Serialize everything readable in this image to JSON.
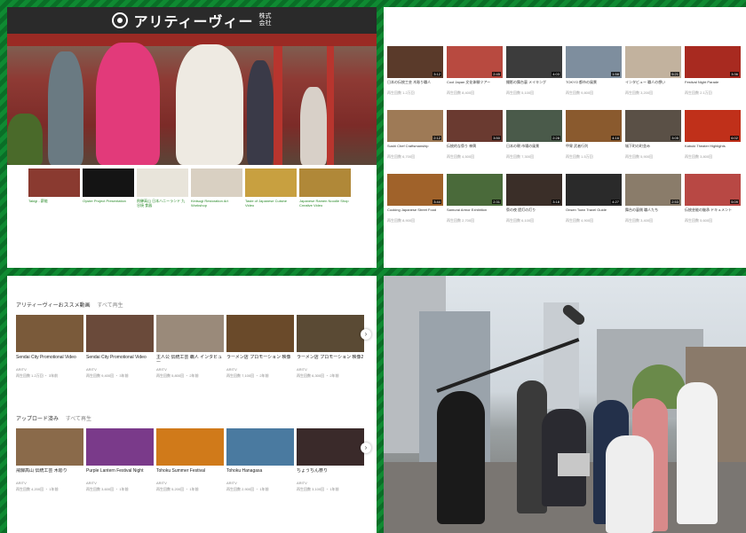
{
  "channel": {
    "logo_text": "アリティーヴィー",
    "logo_sub": "株式会社",
    "strip": [
      {
        "label": "Takigi - 薪能",
        "color": "#8a3a30"
      },
      {
        "label": "Oyster Project Presentation",
        "color": "#141414"
      },
      {
        "label": "飛騨高山 日本ハニーランド 九谷焼 食器",
        "color": "#e8e4da"
      },
      {
        "label": "Kintsugi Restoration Art Workshop",
        "color": "#d9d0c2"
      },
      {
        "label": "Taste of Japanese Cuisine Video",
        "color": "#c8a040"
      },
      {
        "label": "Japanese Ramen Noodle Shop Creative Video",
        "color": "#b08838"
      }
    ]
  },
  "grid": [
    {
      "title": "日本の伝統工芸 木彫り職人",
      "meta": "再生回数 1.2万回",
      "dur": "3:12",
      "color": "#5a3a2a"
    },
    {
      "title": "Cool Japan 文化体験ツアー",
      "meta": "再生回数 8,400回",
      "dur": "2:45",
      "color": "#b84a40"
    },
    {
      "title": "撮影の舞台裏 メイキング",
      "meta": "再生回数 5,100回",
      "dur": "4:03",
      "color": "#3c3c3c"
    },
    {
      "title": "TOKYO 都市の風景",
      "meta": "再生回数 9,800回",
      "dur": "1:58",
      "color": "#7e8e9e"
    },
    {
      "title": "インタビュー 職人の想い",
      "meta": "再生回数 3,200回",
      "dur": "5:21",
      "color": "#c2b29e"
    },
    {
      "title": "Festival Night Parade",
      "meta": "再生回数 2.1万回",
      "dur": "3:36",
      "color": "#a82a20"
    },
    {
      "title": "Sushi Chef Craftsmanship",
      "meta": "再生回数 6,700回",
      "dur": "2:12",
      "color": "#9e7a56"
    },
    {
      "title": "伝統的な祭り 神輿",
      "meta": "再生回数 4,500回",
      "dur": "3:50",
      "color": "#6a3a30"
    },
    {
      "title": "日本の朝 市場の風景",
      "meta": "再生回数 7,300回",
      "dur": "2:28",
      "color": "#4a5a4a"
    },
    {
      "title": "甲冑 武者行列",
      "meta": "再生回数 1.5万回",
      "dur": "4:16",
      "color": "#8a5a2e"
    },
    {
      "title": "城下町の町並み",
      "meta": "再生回数 5,900回",
      "dur": "3:05",
      "color": "#5a5046"
    },
    {
      "title": "Kabuki Theater Highlights",
      "meta": "再生回数 3,800回",
      "dur": "6:02",
      "color": "#c0301a"
    },
    {
      "title": "Cooking Japanese Street Food",
      "meta": "再生回数 8,900回",
      "dur": "3:44",
      "color": "#a0622a"
    },
    {
      "title": "Samurai Armor Exhibition",
      "meta": "再生回数 2,700回",
      "dur": "2:31",
      "color": "#4a6a3a"
    },
    {
      "title": "祭の夜 提灯の灯り",
      "meta": "再生回数 6,100回",
      "dur": "3:18",
      "color": "#3a2e28"
    },
    {
      "title": "Onsen Town Travel Guide",
      "meta": "再生回数 4,900回",
      "dur": "4:27",
      "color": "#2a2a2a"
    },
    {
      "title": "舞台の裏側 職人たち",
      "meta": "再生回数 3,400回",
      "dur": "2:53",
      "color": "#8a7c6a"
    },
    {
      "title": "伝統芸能の継承 ドキュメント",
      "meta": "再生回数 5,600回",
      "dur": "5:09",
      "color": "#b84844"
    }
  ],
  "shelves": [
    {
      "title": "アリティーヴィーおススメ動画",
      "play": "すべて再生",
      "items": [
        {
          "title": "Sendai City Promotional Video",
          "channel": "ARITV",
          "meta": "再生回数 1.2万回 ・ 3年前",
          "color": "#7a5a3a"
        },
        {
          "title": "Sendai City Promotional Video",
          "channel": "ARITV",
          "meta": "再生回数 9,400回 ・ 3年前",
          "color": "#6a4a3a"
        },
        {
          "title": "主人公 伝統工芸 職人 インタビュー",
          "channel": "ARITV",
          "meta": "再生回数 5,800回 ・ 2年前",
          "color": "#9a8a7a"
        },
        {
          "title": "ラーメン店 プロモーション 映像",
          "channel": "ARITV",
          "meta": "再生回数 7,100回 ・ 2年前",
          "color": "#6a4a2a"
        },
        {
          "title": "ラーメン店 プロモーション 映像2",
          "channel": "ARITV",
          "meta": "再生回数 6,300回 ・ 2年前",
          "color": "#5a4a34"
        }
      ]
    },
    {
      "title": "アップロード済み",
      "play": "すべて再生",
      "items": [
        {
          "title": "飛騨高山 伝統工芸 木彫り",
          "channel": "ARITV",
          "meta": "再生回数 4,200回 ・ 1年前",
          "color": "#8a6a4a"
        },
        {
          "title": "Purple Lantern Festival Night",
          "channel": "ARITV",
          "meta": "再生回数 3,600回 ・ 1年前",
          "color": "#7a3a8a"
        },
        {
          "title": "Tohoku Summer Festival",
          "channel": "ARITV",
          "meta": "再生回数 5,200回 ・ 1年前",
          "color": "#d07a1a"
        },
        {
          "title": "Tohoku Hanagasa",
          "channel": "ARITV",
          "meta": "再生回数 2,900回 ・ 1年前",
          "color": "#4a7aa0"
        },
        {
          "title": "ちょうちん祭り",
          "channel": "ARITV",
          "meta": "再生回数 3,100回 ・ 1年前",
          "color": "#3a2a2a"
        }
      ]
    }
  ]
}
